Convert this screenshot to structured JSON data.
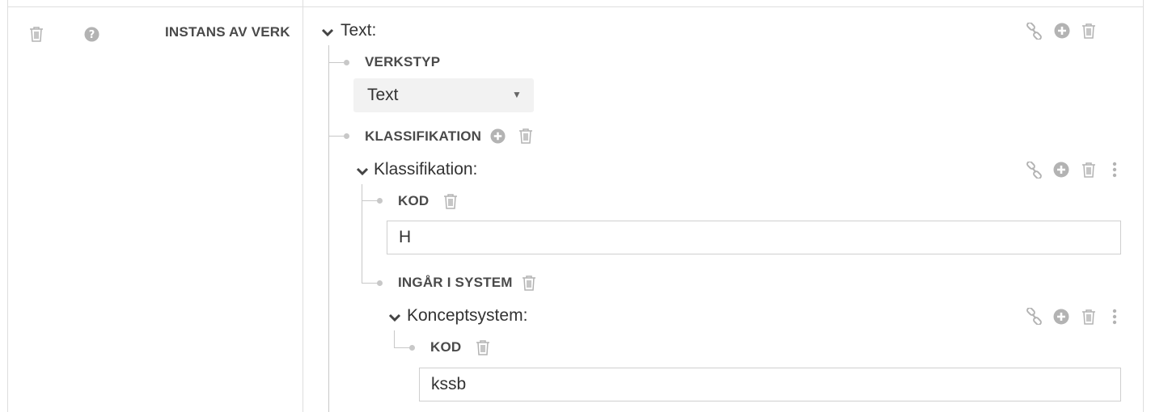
{
  "row": {
    "property_label": "INSTANS AV VERK"
  },
  "text_entity": {
    "title": "Text:",
    "verkstyp": {
      "label": "VERKSTYP",
      "selected": "Text"
    },
    "klassifikation_property": {
      "label": "KLASSIFIKATION"
    },
    "klassifikation_entity": {
      "title": "Klassifikation:",
      "kod": {
        "label": "KOD",
        "value": "H"
      },
      "ingar_i_system": {
        "label": "INGÅR I SYSTEM"
      },
      "konceptsystem": {
        "title": "Konceptsystem:",
        "kod": {
          "label": "KOD",
          "value": "kssb"
        }
      }
    }
  },
  "icons": {
    "trash": "trash-icon",
    "help": "question-circle-icon",
    "link": "link-icon",
    "add": "plus-circle-icon",
    "more": "vertical-ellipsis-icon",
    "chevron": "chevron-down-icon"
  },
  "colors": {
    "icon_gray": "#b3b3b3",
    "border": "#dedede",
    "tree_line": "#c8c8c8",
    "select_bg": "#f2f2f2",
    "text": "#333333"
  }
}
